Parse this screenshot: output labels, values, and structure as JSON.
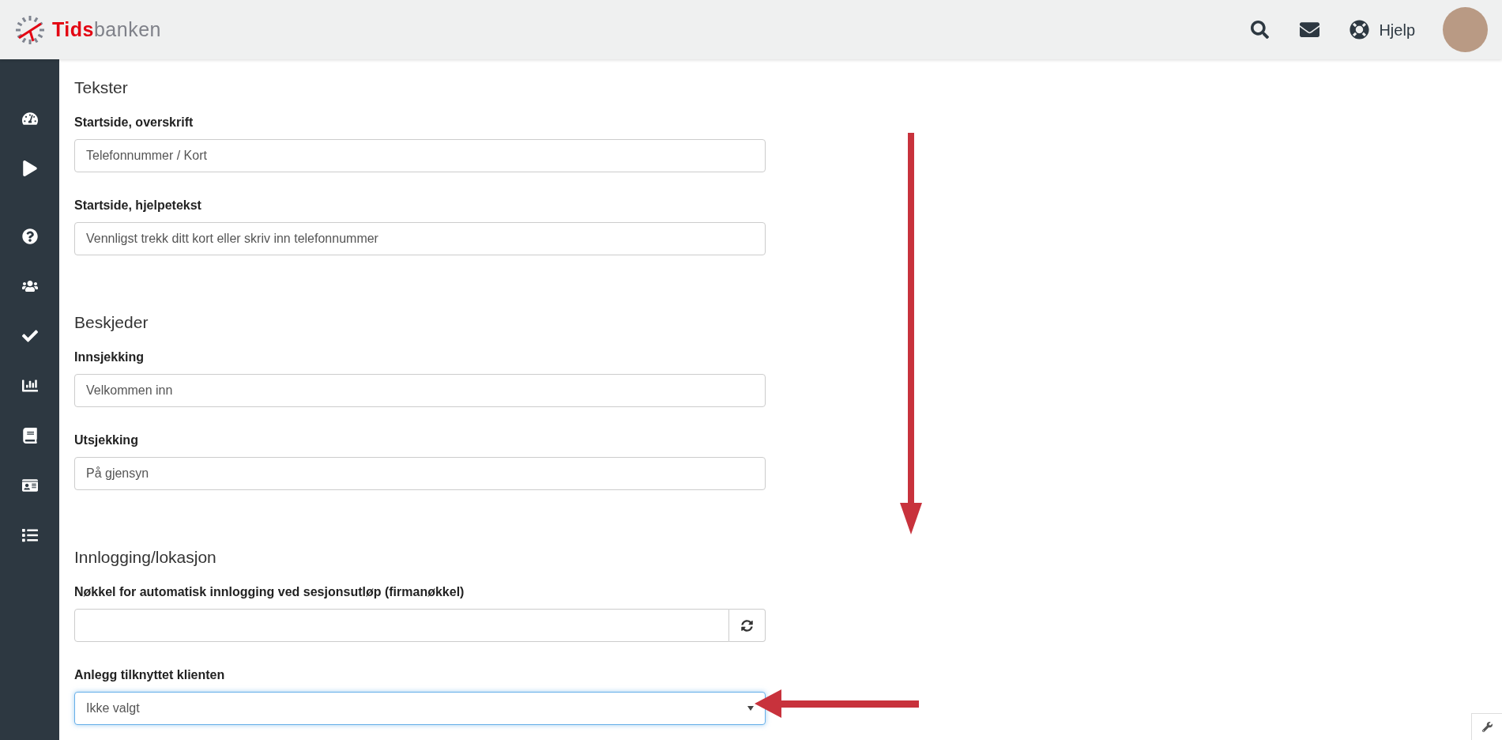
{
  "header": {
    "logo": {
      "part_1": "Tids",
      "part_2": "banken"
    },
    "help_label": "Hjelp"
  },
  "sections": [
    {
      "title": "Tekster",
      "fields": [
        {
          "label": "Startside, overskrift",
          "kind": "text",
          "value": "Telefonnummer / Kort",
          "focused": false
        },
        {
          "label": "Startside, hjelpetekst",
          "kind": "text",
          "value": "Vennligst trekk ditt kort eller skriv inn telefonnummer",
          "focused": false
        }
      ]
    },
    {
      "title": "Beskjeder",
      "fields": [
        {
          "label": "Innsjekking",
          "kind": "text",
          "value": "Velkommen inn",
          "focused": false
        },
        {
          "label": "Utsjekking",
          "kind": "text",
          "value": "På gjensyn",
          "focused": false
        }
      ]
    },
    {
      "title": "Innlogging/lokasjon",
      "fields": [
        {
          "label": "Nøkkel for automatisk innlogging ved sesjonsutløp (firmanøkkel)",
          "kind": "text-with-button",
          "focused": false
        },
        {
          "label": "Anlegg tilknyttet klienten",
          "kind": "select",
          "value": "Ikke valgt",
          "focused": true
        }
      ]
    }
  ]
}
